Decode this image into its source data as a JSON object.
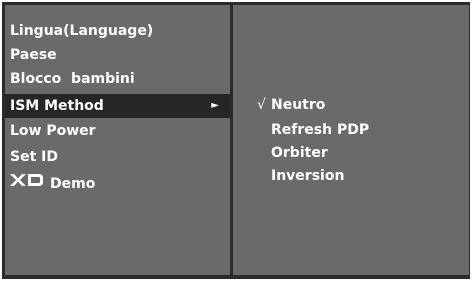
{
  "menu": {
    "items": [
      {
        "label": "Lingua(Language)",
        "selected": false
      },
      {
        "label": "Paese",
        "selected": false
      },
      {
        "label": "Blocco  bambini",
        "selected": false
      },
      {
        "label": "ISM Method",
        "selected": true,
        "arrow": "►"
      },
      {
        "label": "Low Power",
        "selected": false
      },
      {
        "label": "Set ID",
        "selected": false
      },
      {
        "label": "Demo",
        "selected": false,
        "logo": "XD",
        "icon": "xd-logo-icon"
      }
    ]
  },
  "submenu": {
    "items": [
      {
        "label": "Neutro",
        "checked": true,
        "check_mark": "√"
      },
      {
        "label": "Refresh PDP",
        "checked": false
      },
      {
        "label": "Orbiter",
        "checked": false
      },
      {
        "label": "Inversion",
        "checked": false
      }
    ]
  },
  "colors": {
    "panel": "#6a6a6a",
    "frame": "#2b2b2b",
    "highlight": "#262626",
    "text": "#ffffff"
  }
}
